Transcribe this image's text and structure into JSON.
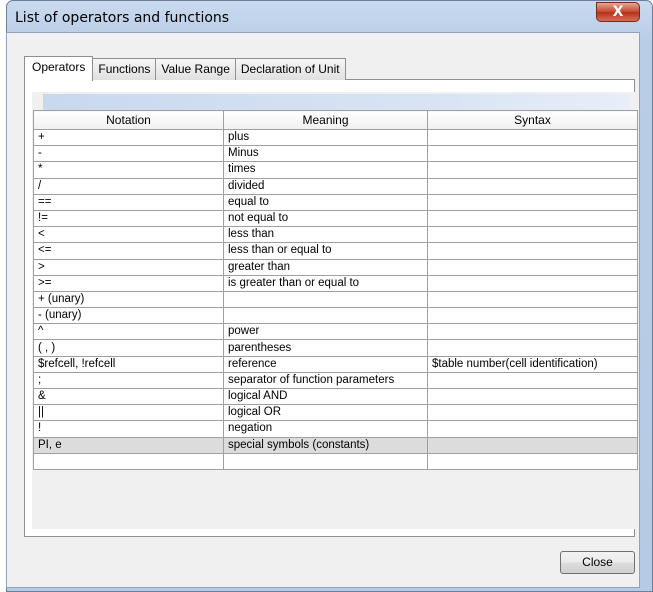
{
  "window": {
    "title": "List of operators and functions",
    "close_glyph": "X"
  },
  "tabs": [
    {
      "label": "Operators",
      "active": true
    },
    {
      "label": "Functions",
      "active": false
    },
    {
      "label": "Value Range",
      "active": false
    },
    {
      "label": "Declaration of Unit",
      "active": false
    }
  ],
  "table": {
    "headers": [
      "Notation",
      "Meaning",
      "Syntax"
    ],
    "rows": [
      [
        "+",
        "plus",
        ""
      ],
      [
        "-",
        "Minus",
        ""
      ],
      [
        "*",
        "times",
        ""
      ],
      [
        "/",
        "divided",
        ""
      ],
      [
        "==",
        "equal to",
        ""
      ],
      [
        "!=",
        "not equal to",
        ""
      ],
      [
        "<",
        "less than",
        ""
      ],
      [
        "<=",
        "less than or equal to",
        ""
      ],
      [
        ">",
        "greater than",
        ""
      ],
      [
        ">=",
        "is greater than or equal to",
        ""
      ],
      [
        "+ (unary)",
        "",
        ""
      ],
      [
        "- (unary)",
        "",
        ""
      ],
      [
        "^",
        "power",
        ""
      ],
      [
        "( , )",
        "parentheses",
        ""
      ],
      [
        "$refcell, !refcell",
        "reference",
        "$table number(cell identification)"
      ],
      [
        ";",
        "separator of function parameters",
        ""
      ],
      [
        "&",
        "logical AND",
        ""
      ],
      [
        "||",
        "logical OR",
        ""
      ],
      [
        "!",
        "negation",
        ""
      ],
      [
        "PI, e",
        "special symbols (constants)",
        ""
      ],
      [
        "",
        "",
        ""
      ]
    ],
    "selected_row": 19
  },
  "buttons": {
    "close_label": "Close"
  }
}
